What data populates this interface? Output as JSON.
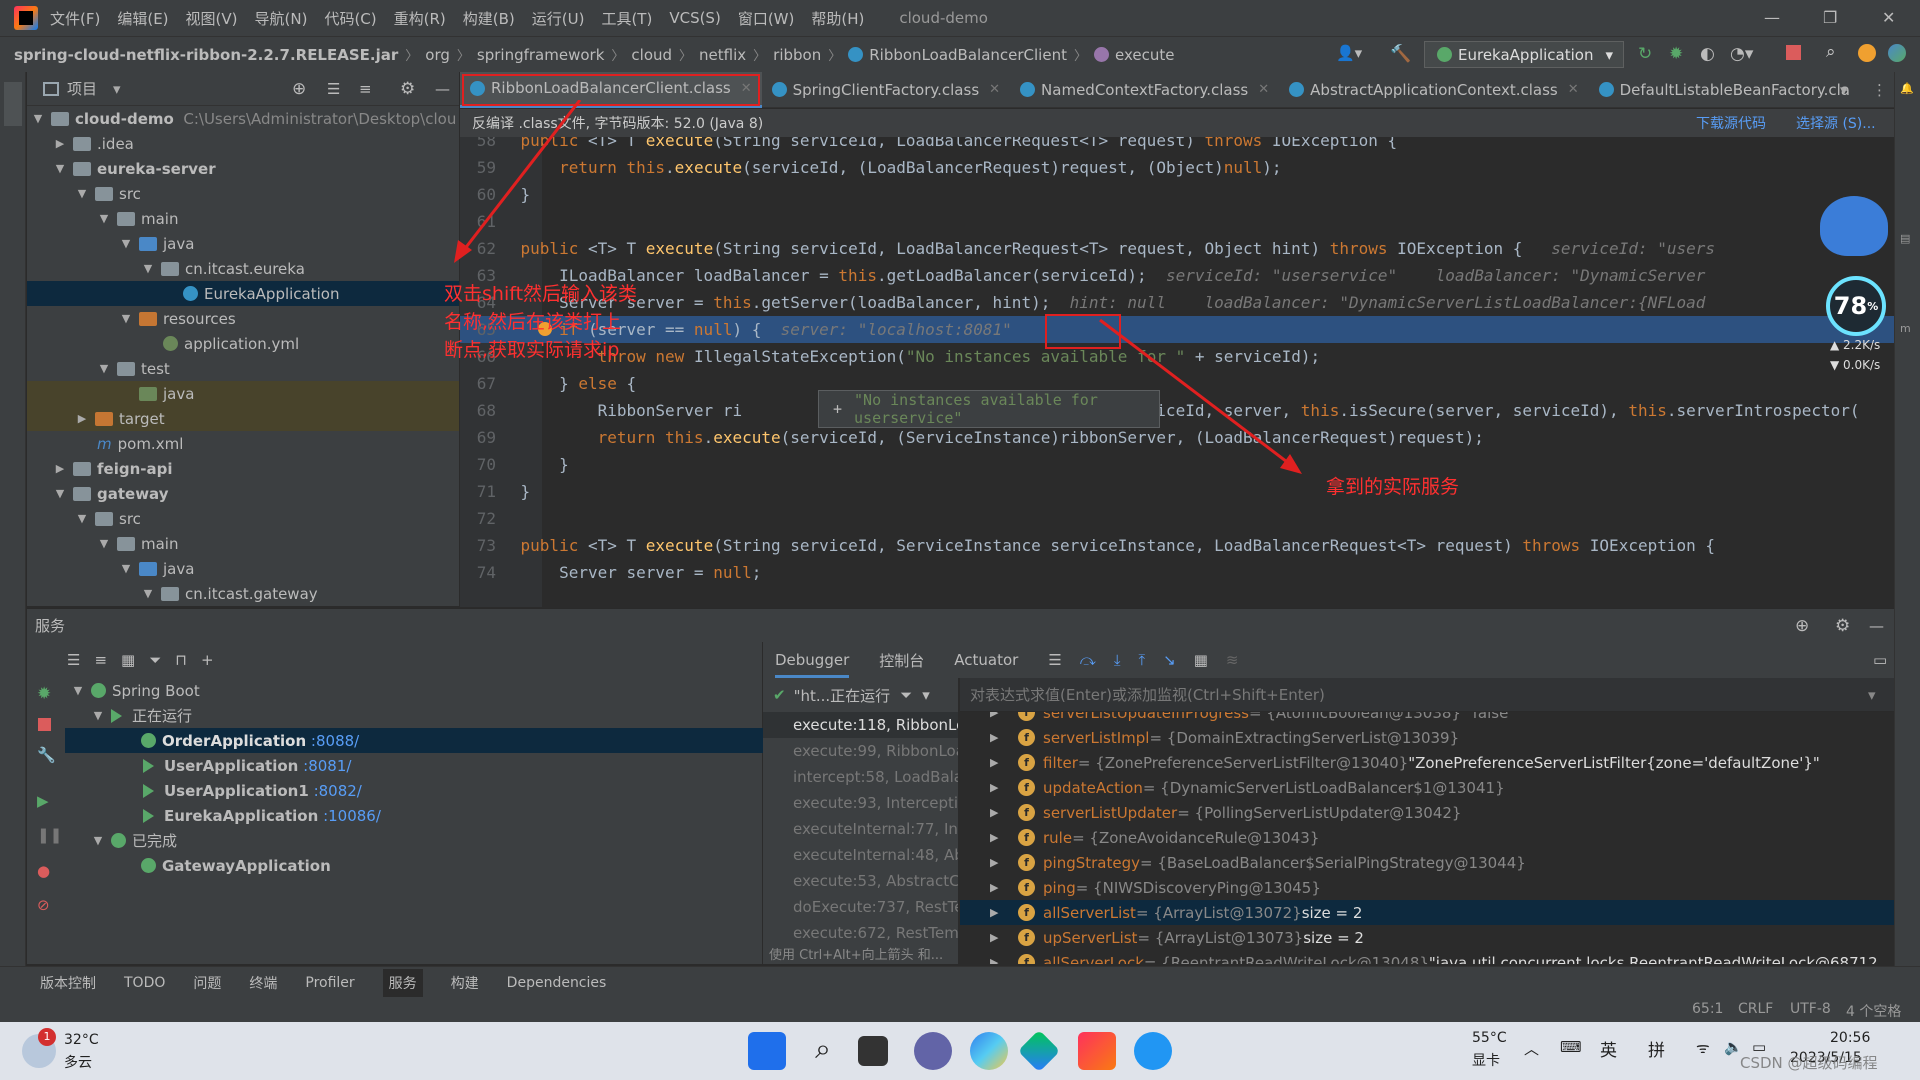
{
  "menubar": {
    "items": [
      "文件(F)",
      "编辑(E)",
      "视图(V)",
      "导航(N)",
      "代码(C)",
      "重构(R)",
      "构建(B)",
      "运行(U)",
      "工具(T)",
      "VCS(S)",
      "窗口(W)",
      "帮助(H)"
    ],
    "project": "cloud-demo"
  },
  "breadcrumb": [
    "spring-cloud-netflix-ribbon-2.2.7.RELEASE.jar",
    "org",
    "springframework",
    "cloud",
    "netflix",
    "ribbon",
    "RibbonLoadBalancerClient",
    "execute"
  ],
  "run_config": "EurekaApplication",
  "project_panel": {
    "title": "项目"
  },
  "tree": [
    {
      "label": "cloud-demo",
      "extra": "C:\\Users\\Administrator\\Desktop\\clou"
    },
    {
      "label": ".idea"
    },
    {
      "label": "eureka-server"
    },
    {
      "label": "src"
    },
    {
      "label": "main"
    },
    {
      "label": "java"
    },
    {
      "label": "cn.itcast.eureka"
    },
    {
      "label": "EurekaApplication"
    },
    {
      "label": "resources"
    },
    {
      "label": "application.yml"
    },
    {
      "label": "test"
    },
    {
      "label": "java"
    },
    {
      "label": "target"
    },
    {
      "label": "pom.xml"
    },
    {
      "label": "feign-api"
    },
    {
      "label": "gateway"
    },
    {
      "label": "src"
    },
    {
      "label": "main"
    },
    {
      "label": "java"
    },
    {
      "label": "cn.itcast.gateway"
    }
  ],
  "tabs": [
    "RibbonLoadBalancerClient.class",
    "SpringClientFactory.class",
    "NamedContextFactory.class",
    "AbstractApplicationContext.class",
    "DefaultListableBeanFactory.cla"
  ],
  "decompiled": {
    "notice": "反编译 .class文件, 字节码版本: 52.0 (Java 8)",
    "download": "下载源代码",
    "choose": "选择源 (S)..."
  },
  "code": [
    {
      "n": "58",
      "t": "    public <T> T execute(String serviceId, LoadBalancerRequest<T> request) throws IOException {"
    },
    {
      "n": "59",
      "t": "        return this.execute(serviceId, (LoadBalancerRequest)request, (Object)null);"
    },
    {
      "n": "60",
      "t": "    }"
    },
    {
      "n": "61",
      "t": ""
    },
    {
      "n": "62",
      "t": "    public <T> T execute(String serviceId, LoadBalancerRequest<T> request, Object hint) throws IOException {",
      "h": "   serviceId: \"users"
    },
    {
      "n": "63",
      "t": "        ILoadBalancer loadBalancer = this.getLoadBalancer(serviceId);",
      "h": "  serviceId: \"userservice\"    loadBalancer: \"DynamicServer"
    },
    {
      "n": "64",
      "t": "        Server server = this.getServer(loadBalancer, hint);",
      "h": "  hint: null    loadBalancer: \"DynamicServerListLoadBalancer:{NFLoad"
    },
    {
      "n": "65",
      "t": "        if (server == null) {",
      "h": "  server: \"localhost:8081\""
    },
    {
      "n": "66",
      "t": "            throw new IllegalStateException(\"No instances available for \" + serviceId);"
    },
    {
      "n": "67",
      "t": "        } else {"
    },
    {
      "n": "68",
      "t": "            RibbonServer ri                                           iceId, server, this.isSecure(server, serviceId), this.serverIntrospector("
    },
    {
      "n": "69",
      "t": "            return this.execute(serviceId, (ServiceInstance)ribbonServer, (LoadBalancerRequest)request);"
    },
    {
      "n": "70",
      "t": "        }"
    },
    {
      "n": "71",
      "t": "    }"
    },
    {
      "n": "72",
      "t": ""
    },
    {
      "n": "73",
      "t": "    public <T> T execute(String serviceId, ServiceInstance serviceInstance, LoadBalancerRequest<T> request) throws IOException {"
    },
    {
      "n": "74",
      "t": "        Server server = null;"
    }
  ],
  "tooltip": "\"No instances available for userservice\"",
  "annotations": {
    "left": "双击shift然后输入该类\n名称,然后在该类打上\n断点,获取实际请求ip",
    "right": "拿到的实际服务"
  },
  "services": {
    "title": "服务",
    "root": "Spring Boot",
    "running": "正在运行",
    "done": "已完成",
    "apps": [
      {
        "name": "OrderApplication",
        "port": ":8088/"
      },
      {
        "name": "UserApplication",
        "port": ":8081/"
      },
      {
        "name": "UserApplication1",
        "port": ":8082/"
      },
      {
        "name": "EurekaApplication",
        "port": ":10086/"
      }
    ],
    "finished": "GatewayApplication"
  },
  "debugger": {
    "tabs": [
      "Debugger",
      "控制台",
      "Actuator"
    ],
    "thread": "\"ht...正在运行",
    "eval_placeholder": "对表达式求值(Enter)或添加监视(Ctrl+Shift+Enter)",
    "frames": [
      "execute:118, RibbonLo",
      "execute:99, RibbonLoa",
      "intercept:58, LoadBalan",
      "execute:93, Interceptin",
      "executeInternal:77, Inte",
      "executeInternal:48, Abs",
      "execute:53, AbstractCli",
      "doExecute:737, RestTe",
      "execute:672, RestTem"
    ],
    "frames_hint": "使用 Ctrl+Alt+向上箭头 和...",
    "vars": [
      {
        "name": "serverListUpdateInProgress",
        "val": "= {AtomicBoolean@13038} \"false\""
      },
      {
        "name": "serverListImpl",
        "val": "= {DomainExtractingServerList@13039}"
      },
      {
        "name": "filter",
        "val": "= {ZonePreferenceServerListFilter@13040}",
        "s": "\"ZonePreferenceServerListFilter{zone='defaultZone'}\""
      },
      {
        "name": "updateAction",
        "val": "= {DynamicServerListLoadBalancer$1@13041}"
      },
      {
        "name": "serverListUpdater",
        "val": "= {PollingServerListUpdater@13042}"
      },
      {
        "name": "rule",
        "val": "= {ZoneAvoidanceRule@13043}"
      },
      {
        "name": "pingStrategy",
        "val": "= {BaseLoadBalancer$SerialPingStrategy@13044}"
      },
      {
        "name": "ping",
        "val": "= {NIWSDiscoveryPing@13045}"
      },
      {
        "name": "allServerList",
        "val": "= {ArrayList@13072}",
        "s": " size = 2"
      },
      {
        "name": "upServerList",
        "val": "= {ArrayList@13073}",
        "s": " size = 2"
      },
      {
        "name": "allServerLock",
        "val": "= {ReentrantReadWriteLock@13048}",
        "s": "\"java.util.concurrent.locks.ReentrantReadWriteLock@68712"
      }
    ]
  },
  "bottom_tabs": [
    "版本控制",
    "TODO",
    "问题",
    "终端",
    "Profiler",
    "服务",
    "构建",
    "Dependencies"
  ],
  "status": {
    "pos": "65:1",
    "eol": "CRLF",
    "enc": "UTF-8",
    "indent": "4 个空格"
  },
  "widget": {
    "percent": "78",
    "up": "2.2",
    "down": "0.0",
    "unit": "K/s"
  },
  "taskbar": {
    "weather_temp": "32°C",
    "weather_desc": "多云",
    "badge": "1",
    "gpu_temp": "55°C",
    "gpu_label": "显卡",
    "lang1": "英",
    "lang2": "拼",
    "time": "20:56",
    "date": "2023/5/15",
    "watermark": "CSDN @超级码编程"
  }
}
